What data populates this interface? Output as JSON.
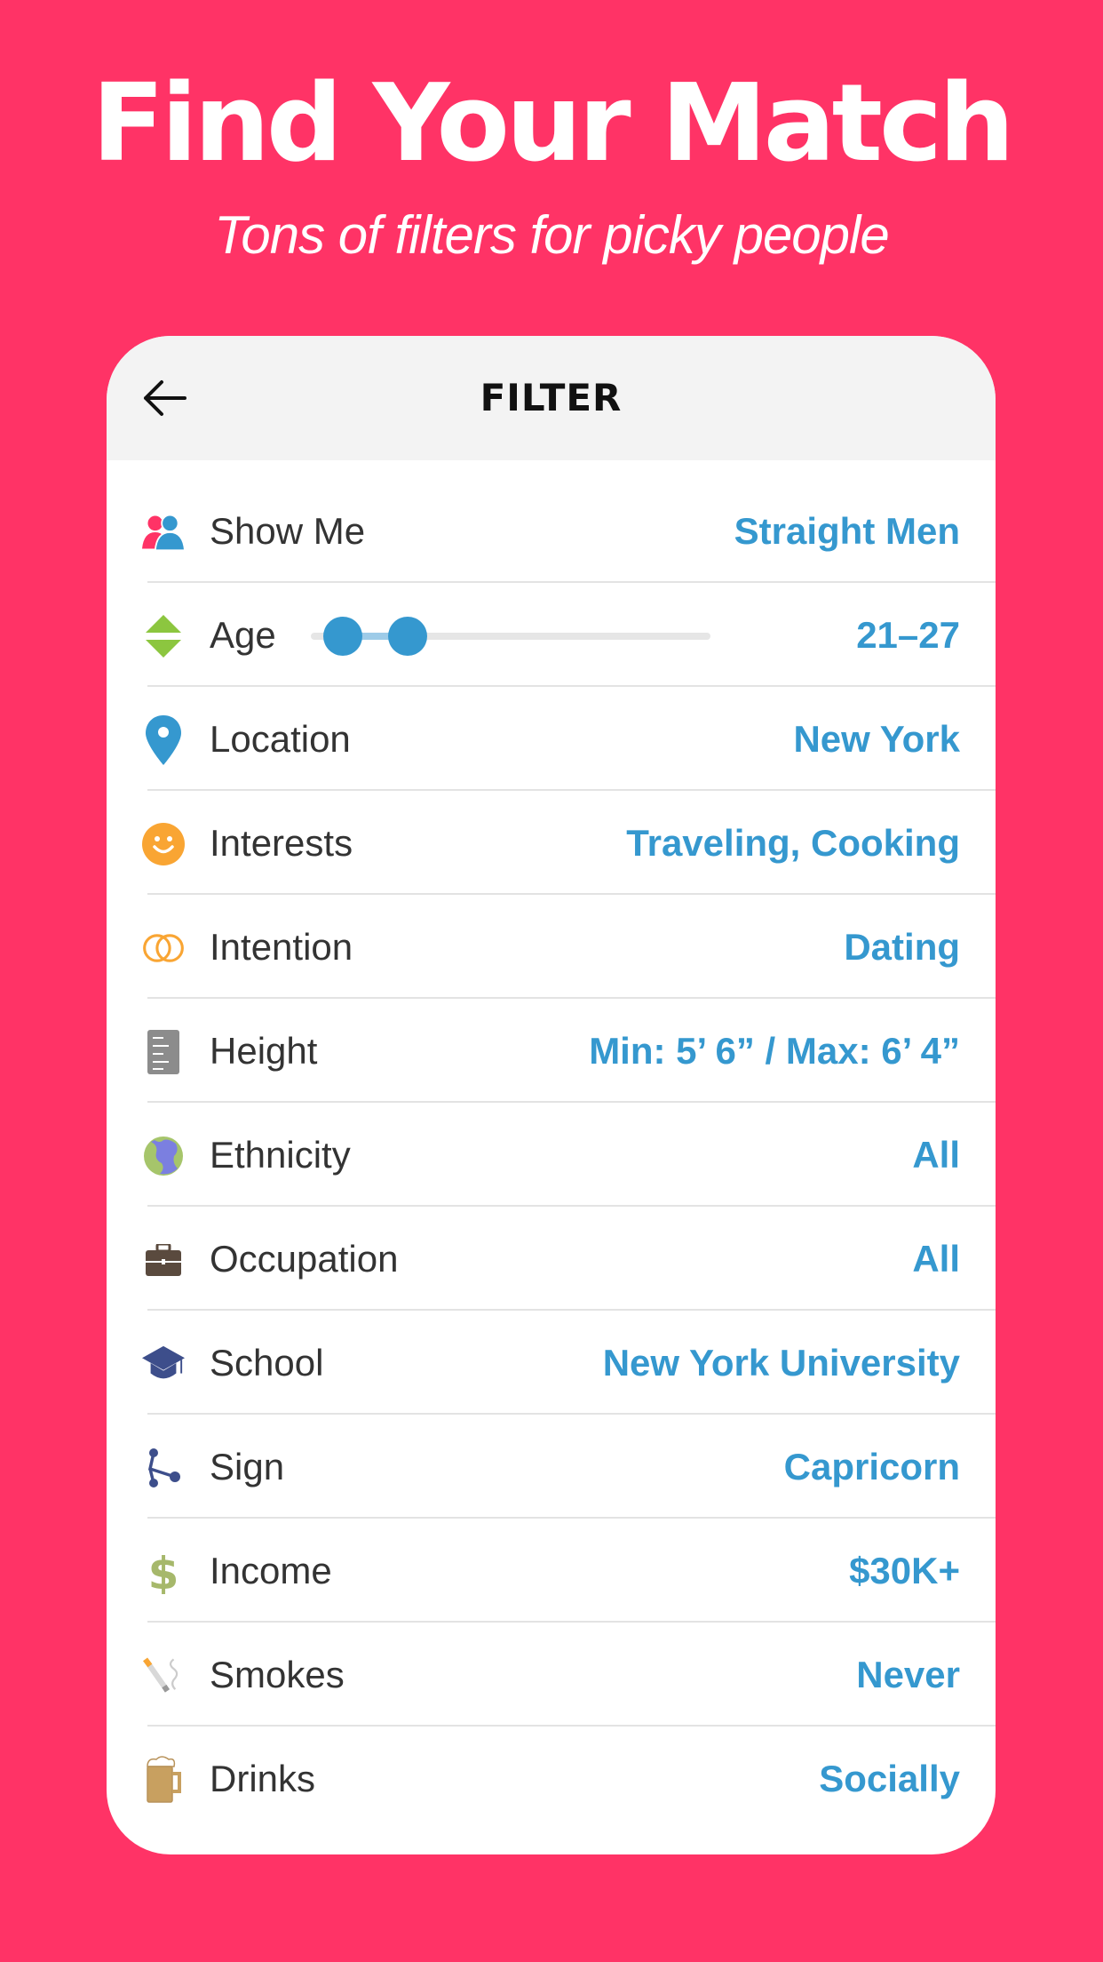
{
  "hero": {
    "title": "Find Your Match",
    "subtitle": "Tons of filters for picky people"
  },
  "colors": {
    "background": "#ff3366",
    "accent": "#3598cf",
    "header_bg": "#f3f3f3"
  },
  "header": {
    "back_icon": "arrow-left-icon",
    "title": "FILTER"
  },
  "age_slider": {
    "min": 18,
    "max": 55,
    "low": 21,
    "high": 27
  },
  "filters": [
    {
      "icon": "people-icon",
      "label": "Show Me",
      "value": "Straight Men"
    },
    {
      "icon": "up-down-arrows-icon",
      "label": "Age",
      "value": "21–27"
    },
    {
      "icon": "location-pin-icon",
      "label": "Location",
      "value": "New York"
    },
    {
      "icon": "smiley-icon",
      "label": "Interests",
      "value": "Traveling, Cooking"
    },
    {
      "icon": "rings-icon",
      "label": "Intention",
      "value": "Dating"
    },
    {
      "icon": "ruler-icon",
      "label": "Height",
      "value": "Min: 5’ 6” / Max: 6’ 4”"
    },
    {
      "icon": "globe-icon",
      "label": "Ethnicity",
      "value": "All"
    },
    {
      "icon": "briefcase-icon",
      "label": "Occupation",
      "value": "All"
    },
    {
      "icon": "graduation-cap-icon",
      "label": "School",
      "value": "New York University"
    },
    {
      "icon": "share-nodes-icon",
      "label": "Sign",
      "value": "Capricorn"
    },
    {
      "icon": "dollar-icon",
      "label": "Income",
      "value": "$30K+"
    },
    {
      "icon": "cigarette-icon",
      "label": "Smokes",
      "value": "Never"
    },
    {
      "icon": "beer-mug-icon",
      "label": "Drinks",
      "value": "Socially"
    }
  ]
}
